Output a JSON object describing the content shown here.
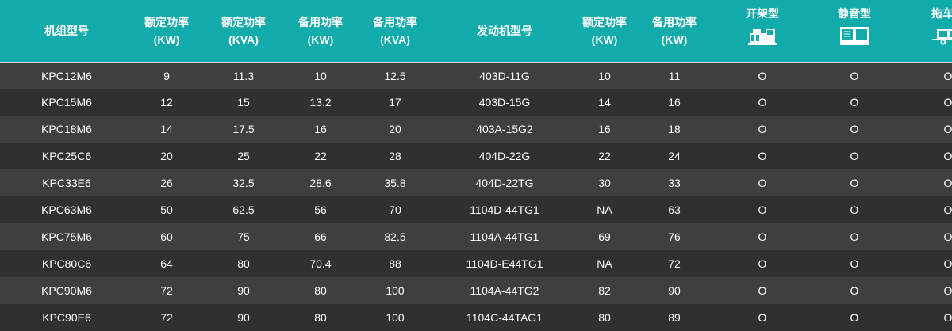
{
  "headers": {
    "model": "机组型号",
    "rated_kw": {
      "title": "额定功率",
      "unit": "(KW)"
    },
    "rated_kva": {
      "title": "额定功率",
      "unit": "(KVA)"
    },
    "standby_kw": {
      "title": "备用功率",
      "unit": "(KW)"
    },
    "standby_kva": {
      "title": "备用功率",
      "unit": "(KVA)"
    },
    "engine_model": "发动机型号",
    "engine_rated_kw": {
      "title": "额定功率",
      "unit": "(KW)"
    },
    "engine_standby_kw": {
      "title": "备用功率",
      "unit": "(KW)"
    },
    "open_type": {
      "title": "开架型",
      "icon": "open-frame-generator-icon"
    },
    "silent_type": {
      "title": "静音型",
      "icon": "silent-generator-icon"
    },
    "trailer_type": {
      "title": "拖车型",
      "icon": "trailer-generator-icon"
    }
  },
  "rows": [
    [
      "KPC12M6",
      "9",
      "11.3",
      "10",
      "12.5",
      "403D-11G",
      "10",
      "11",
      "O",
      "O",
      "O"
    ],
    [
      "KPC15M6",
      "12",
      "15",
      "13.2",
      "17",
      "403D-15G",
      "14",
      "16",
      "O",
      "O",
      "O"
    ],
    [
      "KPC18M6",
      "14",
      "17.5",
      "16",
      "20",
      "403A-15G2",
      "16",
      "18",
      "O",
      "O",
      "O"
    ],
    [
      "KPC25C6",
      "20",
      "25",
      "22",
      "28",
      "404D-22G",
      "22",
      "24",
      "O",
      "O",
      "O"
    ],
    [
      "KPC33E6",
      "26",
      "32.5",
      "28.6",
      "35.8",
      "404D-22TG",
      "30",
      "33",
      "O",
      "O",
      "O"
    ],
    [
      "KPC63M6",
      "50",
      "62.5",
      "56",
      "70",
      "1104D-44TG1",
      "NA",
      "63",
      "O",
      "O",
      "O"
    ],
    [
      "KPC75M6",
      "60",
      "75",
      "66",
      "82.5",
      "1104A-44TG1",
      "69",
      "76",
      "O",
      "O",
      "O"
    ],
    [
      "KPC80C6",
      "64",
      "80",
      "70.4",
      "88",
      "1104D-E44TG1",
      "NA",
      "72",
      "O",
      "O",
      "O"
    ],
    [
      "KPC90M6",
      "72",
      "90",
      "80",
      "100",
      "1104A-44TG2",
      "82",
      "90",
      "O",
      "O",
      "O"
    ],
    [
      "KPC90E6",
      "72",
      "90",
      "80",
      "100",
      "1104C-44TAG1",
      "80",
      "89",
      "O",
      "O",
      "O"
    ]
  ],
  "colors": {
    "header_bg": "#12abab",
    "row_odd": "#3f3f3f",
    "row_even": "#303030"
  }
}
